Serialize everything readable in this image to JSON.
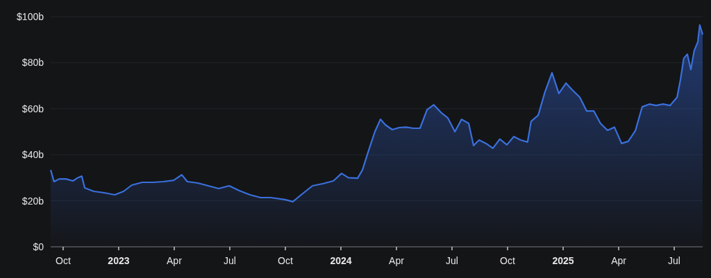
{
  "chart_data": {
    "type": "area",
    "grid": true,
    "xlim": [
      2022.694,
      2025.628
    ],
    "ylim": [
      0,
      100
    ],
    "xticks": [
      {
        "value": 2022.75,
        "label": "Oct"
      },
      {
        "value": 2023,
        "label": "2023"
      },
      {
        "value": 2023.25,
        "label": "Apr"
      },
      {
        "value": 2023.5,
        "label": "Jul"
      },
      {
        "value": 2023.75,
        "label": "Oct"
      },
      {
        "value": 2024,
        "label": "2024"
      },
      {
        "value": 2024.25,
        "label": "Apr"
      },
      {
        "value": 2024.5,
        "label": "Jul"
      },
      {
        "value": 2024.75,
        "label": "Oct"
      },
      {
        "value": 2025,
        "label": "2025"
      },
      {
        "value": 2025.25,
        "label": "Apr"
      },
      {
        "value": 2025.5,
        "label": "Jul"
      }
    ],
    "yticks": [
      {
        "value": 0,
        "label": "$0"
      },
      {
        "value": 20,
        "label": "$20b"
      },
      {
        "value": 40,
        "label": "$40b"
      },
      {
        "value": 60,
        "label": "$60b"
      },
      {
        "value": 80,
        "label": "$80b"
      },
      {
        "value": 100,
        "label": "$100b"
      }
    ],
    "x": [
      2022.694,
      2022.709,
      2022.732,
      2022.763,
      2022.794,
      2022.816,
      2022.834,
      2022.847,
      2022.888,
      2022.934,
      2022.982,
      2023.022,
      2023.059,
      2023.106,
      2023.153,
      2023.2,
      2023.247,
      2023.284,
      2023.309,
      2023.356,
      2023.403,
      2023.45,
      2023.497,
      2023.543,
      2023.591,
      2023.638,
      2023.684,
      2023.747,
      2023.784,
      2023.825,
      2023.872,
      2023.918,
      2023.966,
      2024.003,
      2024.034,
      2024.075,
      2024.097,
      2024.122,
      2024.153,
      2024.178,
      2024.2,
      2024.231,
      2024.263,
      2024.293,
      2024.325,
      2024.356,
      2024.388,
      2024.418,
      2024.45,
      2024.481,
      2024.513,
      2024.543,
      2024.575,
      2024.597,
      2024.622,
      2024.653,
      2024.684,
      2024.715,
      2024.747,
      2024.778,
      2024.809,
      2024.84,
      2024.856,
      2024.888,
      2024.918,
      2024.95,
      2024.981,
      2025.013,
      2025.043,
      2025.075,
      2025.106,
      2025.138,
      2025.168,
      2025.2,
      2025.231,
      2025.263,
      2025.293,
      2025.325,
      2025.356,
      2025.388,
      2025.418,
      2025.45,
      2025.481,
      2025.513,
      2025.528,
      2025.543,
      2025.559,
      2025.575,
      2025.59,
      2025.606,
      2025.615,
      2025.628
    ],
    "values": [
      33.4,
      28.3,
      29.5,
      29.5,
      28.6,
      30,
      30.7,
      25.6,
      24.1,
      23.5,
      22.6,
      24.1,
      26.8,
      28,
      28,
      28.3,
      28.9,
      31.3,
      28.3,
      27.7,
      26.5,
      25.3,
      26.5,
      24.4,
      22.6,
      21.4,
      21.4,
      20.5,
      19.6,
      22.9,
      26.5,
      27.4,
      28.6,
      31.9,
      30,
      29.8,
      33.4,
      41,
      50,
      55.4,
      53,
      50.9,
      51.8,
      52,
      51.5,
      51.5,
      59.6,
      61.7,
      58.4,
      56,
      50,
      55.4,
      53.6,
      44,
      46.4,
      44.9,
      42.8,
      46.8,
      44.3,
      47.9,
      46.4,
      45.5,
      54.5,
      57.2,
      67.2,
      75.6,
      66.6,
      71.1,
      68,
      65,
      59,
      59,
      53.6,
      50.6,
      52,
      44.9,
      45.8,
      50.4,
      60.8,
      62,
      61.4,
      62,
      61.4,
      65,
      72.6,
      81.9,
      83.7,
      77,
      85.2,
      89,
      96.4,
      92.2
    ]
  }
}
